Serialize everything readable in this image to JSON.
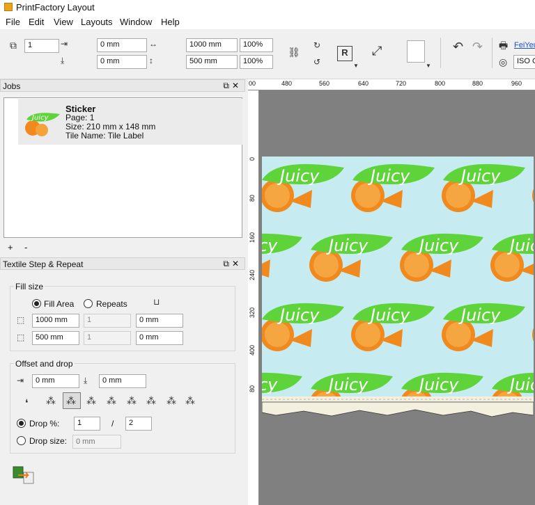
{
  "app": {
    "title": "PrintFactory Layout"
  },
  "menu": [
    "File",
    "Edit",
    "View",
    "Layouts",
    "Window",
    "Help"
  ],
  "toolbar": {
    "copies": "1",
    "x_offset": "0 mm",
    "y_offset": "0 mm",
    "width": "1000 mm",
    "height": "500 mm",
    "width_pct": "100%",
    "height_pct": "100%",
    "printer_name": "FeiYeu",
    "profile": "ISO C"
  },
  "jobs_panel": {
    "title": "Jobs",
    "item": {
      "name": "Sticker",
      "page": "Page: 1",
      "size": "Size: 210 mm x 148 mm",
      "tile": "Tile Name: Tile Label",
      "thumb_text": "Juicy"
    },
    "add": "+",
    "remove": "-"
  },
  "tsr_panel": {
    "title": "Textile Step & Repeat",
    "fill_size": {
      "label": "Fill size",
      "fill_area": "Fill Area",
      "repeats": "Repeats",
      "width": "1000 mm",
      "width_repeats": "1",
      "width_gap": "0 mm",
      "height": "500 mm",
      "height_repeats": "1",
      "height_gap": "0 mm"
    },
    "offset_drop": {
      "label": "Offset and drop",
      "x": "0 mm",
      "y": "0 mm",
      "drop_pct_label": "Drop %:",
      "drop_num": "1",
      "drop_sep": "/",
      "drop_den": "2",
      "drop_size_label": "Drop size:",
      "drop_size_placeholder": "0 mm"
    }
  },
  "ruler": {
    "h": [
      "00",
      "480",
      "560",
      "640",
      "720",
      "800",
      "880",
      "960"
    ],
    "v": [
      "0",
      "80",
      "160",
      "240",
      "320",
      "400",
      "80"
    ]
  },
  "pattern": {
    "text": "Juicy"
  },
  "colors": {
    "pattern_bg": "#c6ecf2",
    "leaf": "#5fd43a",
    "orange": "#f08a1f",
    "workspace": "#808080"
  }
}
